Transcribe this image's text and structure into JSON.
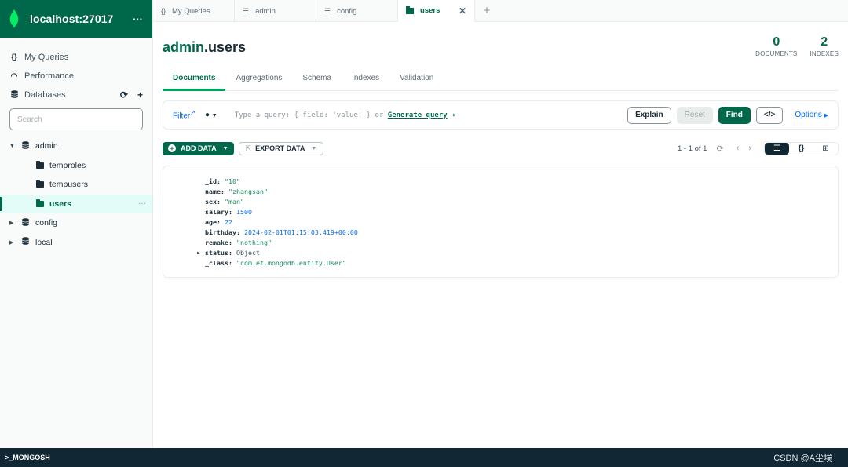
{
  "connection": {
    "title": "localhost:27017",
    "more_icon": "ellipsis-icon"
  },
  "sidebar": {
    "nav": [
      {
        "label": "My Queries",
        "icon": "braces-icon"
      },
      {
        "label": "Performance",
        "icon": "gauge-icon"
      },
      {
        "label": "Databases",
        "icon": "database-icon"
      }
    ],
    "search_placeholder": "Search",
    "databases": [
      {
        "name": "admin",
        "expanded": true,
        "collections": [
          "temproles",
          "tempusers",
          "users"
        ],
        "active_collection": "users"
      },
      {
        "name": "config",
        "expanded": false
      },
      {
        "name": "local",
        "expanded": false
      }
    ]
  },
  "tabs": [
    {
      "label": "My Queries",
      "icon": "braces-icon"
    },
    {
      "label": "admin",
      "icon": "database-icon"
    },
    {
      "label": "config",
      "icon": "database-icon"
    },
    {
      "label": "users",
      "icon": "folder-icon",
      "active": true
    }
  ],
  "header": {
    "db": "admin",
    "collection": ".users",
    "stats": [
      {
        "value": "0",
        "label": "DOCUMENTS"
      },
      {
        "value": "2",
        "label": "INDEXES"
      }
    ]
  },
  "subtabs": [
    "Documents",
    "Aggregations",
    "Schema",
    "Indexes",
    "Validation"
  ],
  "query": {
    "filter_label": "Filter",
    "placeholder": "Type a query: { field: 'value' } or ",
    "generate_label": "Generate query",
    "buttons": {
      "explain": "Explain",
      "reset": "Reset",
      "find": "Find",
      "code": "</>"
    },
    "options_label": "Options"
  },
  "actions": {
    "add_data": "ADD DATA",
    "export_data": "EXPORT DATA",
    "pagination": "1 - 1 of 1"
  },
  "document": {
    "fields": [
      {
        "key": "_id",
        "value": "\"10\"",
        "type": "str"
      },
      {
        "key": "name",
        "value": "\"zhangsan\"",
        "type": "str"
      },
      {
        "key": "sex",
        "value": "\"man\"",
        "type": "str"
      },
      {
        "key": "salary",
        "value": "1500",
        "type": "num"
      },
      {
        "key": "age",
        "value": "22",
        "type": "num"
      },
      {
        "key": "birthday",
        "value": "2024-02-01T01:15:03.419+00:00",
        "type": "num"
      },
      {
        "key": "remake",
        "value": "\"nothing\"",
        "type": "str"
      },
      {
        "key": "status",
        "value": "Object",
        "type": "obj"
      },
      {
        "key": "_class",
        "value": "\"com.et.mongodb.entity.User\"",
        "type": "str"
      }
    ]
  },
  "shell": {
    "label": ">_MONGOSH"
  },
  "watermark": "CSDN @A尘埃"
}
